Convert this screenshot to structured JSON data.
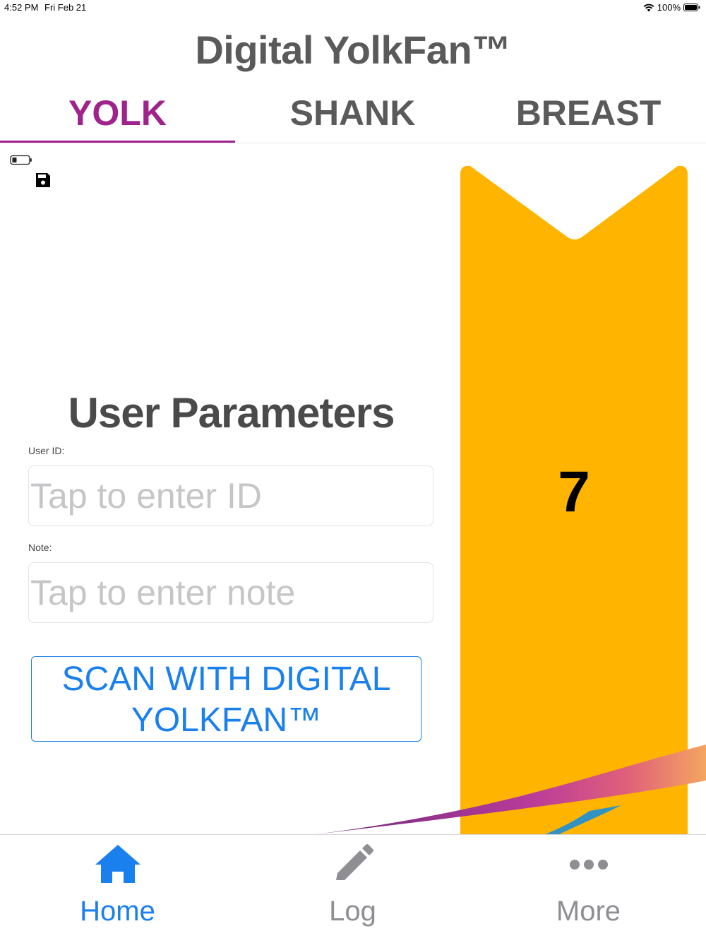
{
  "status_bar": {
    "time": "4:52 PM",
    "date": "Fri Feb 21",
    "battery": "100%"
  },
  "app": {
    "title": "Digital YolkFan™"
  },
  "tabs": [
    {
      "label": "YOLK",
      "active": true
    },
    {
      "label": "SHANK",
      "active": false
    },
    {
      "label": "BREAST",
      "active": false
    }
  ],
  "reading": {
    "value": "7",
    "color": "#FFB500"
  },
  "form": {
    "title": "User Parameters",
    "user_id": {
      "label": "User ID:",
      "placeholder": "Tap to enter ID",
      "value": ""
    },
    "note": {
      "label": "Note:",
      "placeholder": "Tap to enter note",
      "value": ""
    },
    "scan_button": "SCAN WITH DIGITAL YOLKFAN™"
  },
  "tab_bar": [
    {
      "label": "Home",
      "icon": "home-icon",
      "selected": true
    },
    {
      "label": "Log",
      "icon": "pencil-icon",
      "selected": false
    },
    {
      "label": "More",
      "icon": "more-icon",
      "selected": false
    }
  ],
  "colors": {
    "accent": "#A0228C",
    "link": "#1A80EE",
    "inactive": "#8E8E93"
  }
}
